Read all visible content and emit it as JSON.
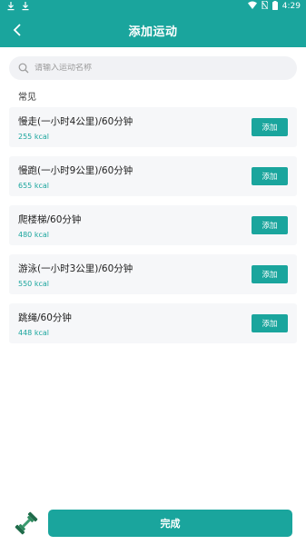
{
  "status_bar": {
    "time": "4:29",
    "left_icons": [
      "download-icon",
      "download-icon"
    ],
    "right_icons": [
      "wifi-icon",
      "no-sim-icon",
      "battery-icon"
    ]
  },
  "header": {
    "title": "添加运动",
    "back_icon": "back-chevron-icon"
  },
  "search": {
    "placeholder": "请输入运动名称",
    "icon": "search-icon"
  },
  "section_title": "常见",
  "exercises": [
    {
      "name": "慢走(一小时4公里)/60分钟",
      "kcal": "255 kcal",
      "add_label": "添加"
    },
    {
      "name": "慢跑(一小时9公里)/60分钟",
      "kcal": "655 kcal",
      "add_label": "添加"
    },
    {
      "name": "爬楼梯/60分钟",
      "kcal": "480 kcal",
      "add_label": "添加"
    },
    {
      "name": "游泳(一小时3公里)/60分钟",
      "kcal": "550 kcal",
      "add_label": "添加"
    },
    {
      "name": "跳绳/60分钟",
      "kcal": "448 kcal",
      "add_label": "添加"
    }
  ],
  "footer": {
    "icon": "dumbbell-icon",
    "done_label": "完成"
  },
  "colors": {
    "primary": "#1aa59d",
    "card_bg": "#f6f7f9",
    "search_bg": "#f1f2f5"
  }
}
